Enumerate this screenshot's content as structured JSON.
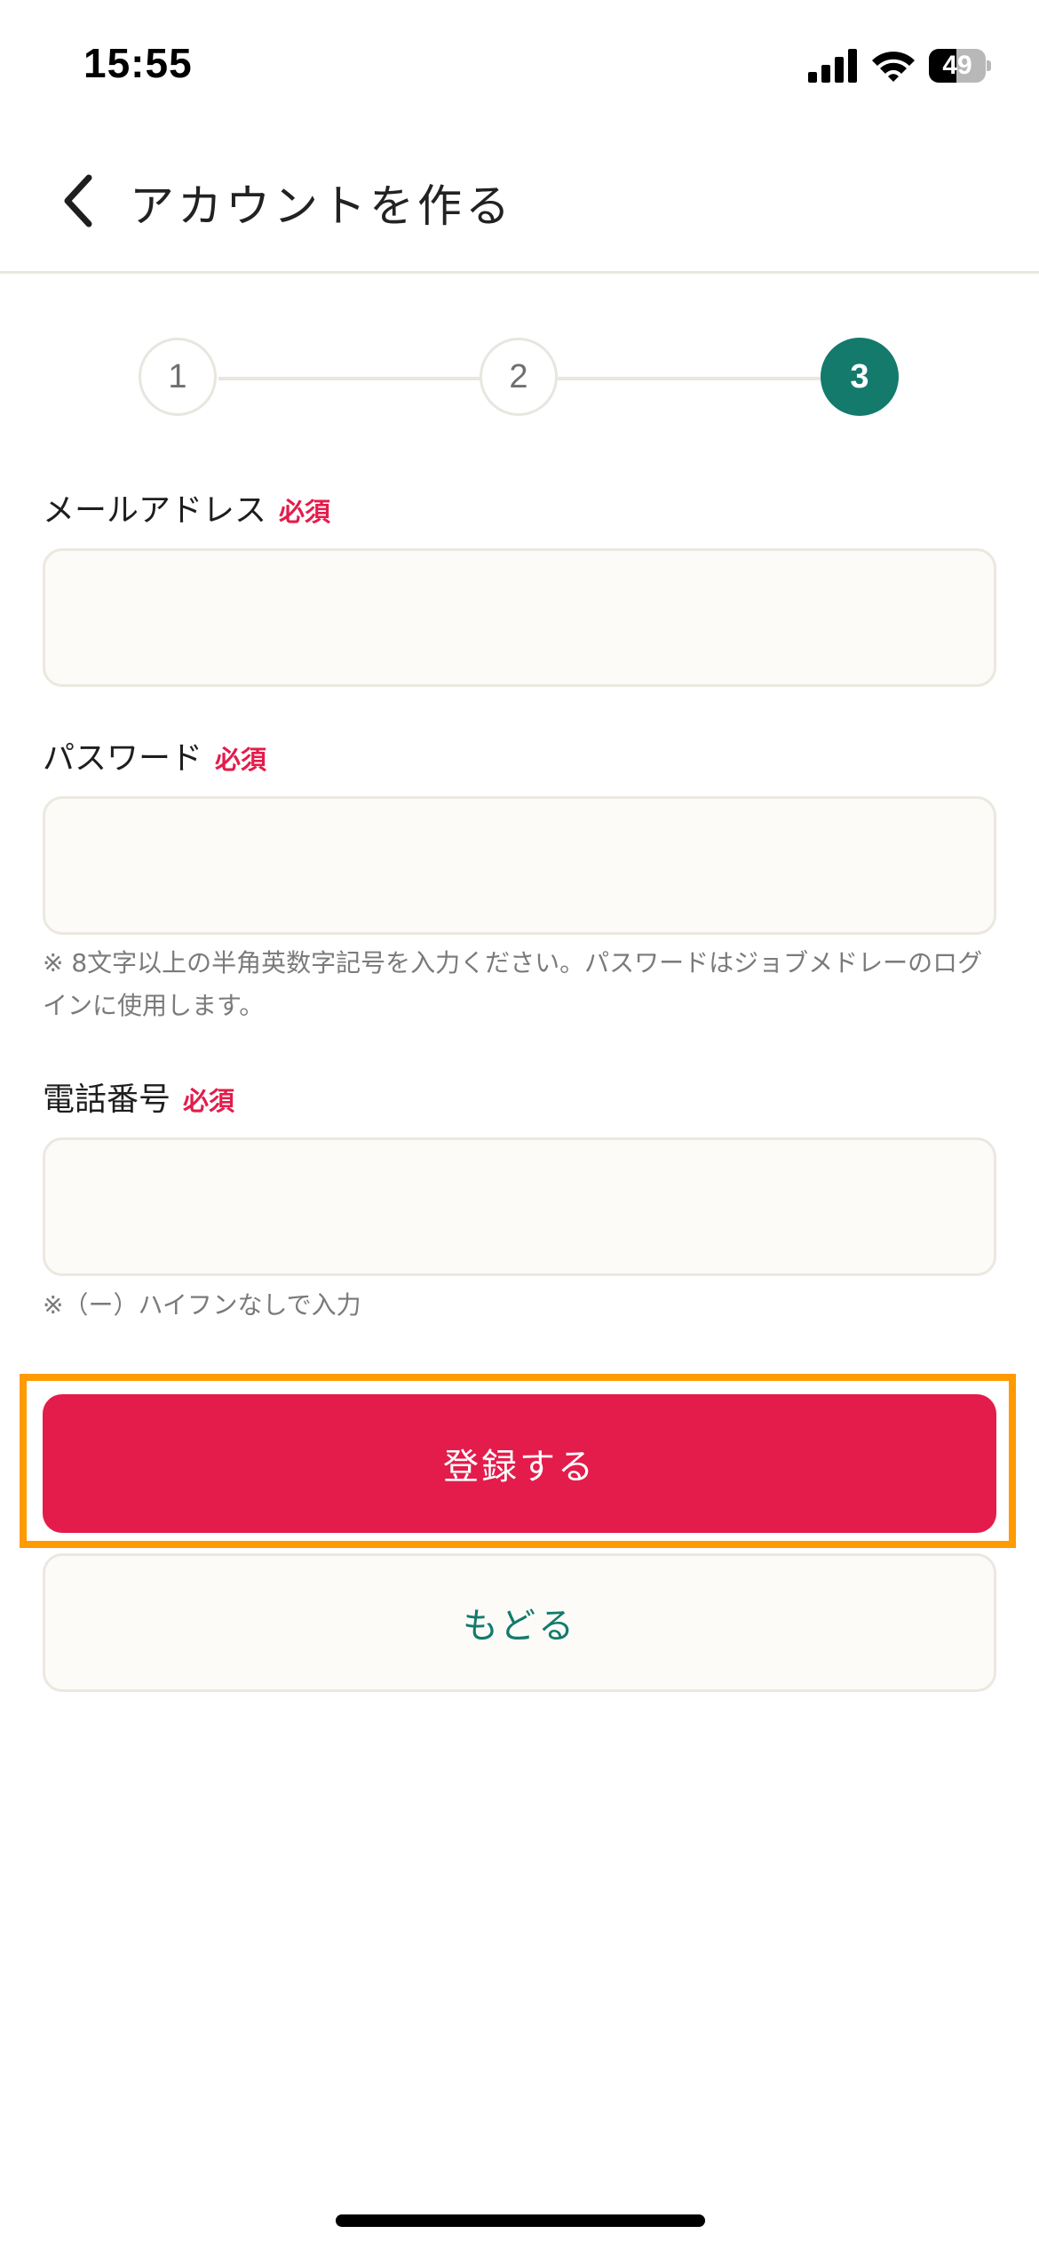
{
  "status_bar": {
    "time": "15:55",
    "battery_level": "49",
    "battery_fraction": 0.49
  },
  "header": {
    "title": "アカウントを作る",
    "back_icon": "chevron-left-icon"
  },
  "stepper": {
    "steps": [
      "1",
      "2",
      "3"
    ],
    "active_step": 3,
    "active_color": "#137a6c"
  },
  "form": {
    "email": {
      "label": "メールアドレス",
      "required": "必須",
      "value": ""
    },
    "password": {
      "label": "パスワード",
      "required": "必須",
      "value": "",
      "note": "※ 8文字以上の半角英数字記号を入力ください。パスワードはジョブメドレーのログインに使用します。"
    },
    "phone": {
      "label": "電話番号",
      "required": "必須",
      "value": "",
      "note": "※（ー）ハイフンなしで入力"
    }
  },
  "buttons": {
    "register_label": "登録する",
    "back_label": "もどる"
  },
  "colors": {
    "primary": "#e31c4b",
    "accent": "#137a6c",
    "highlight": "#ff9a00",
    "input_bg": "#fcfbf7"
  }
}
